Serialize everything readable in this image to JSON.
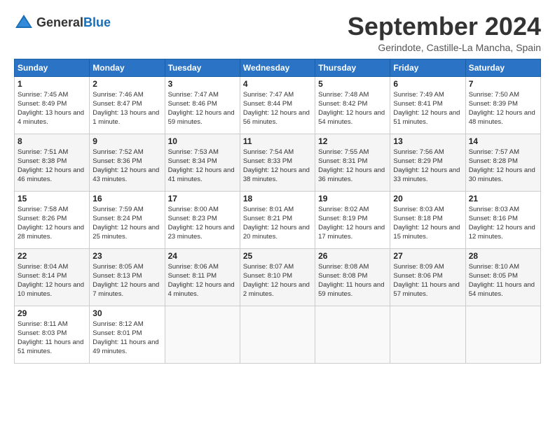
{
  "header": {
    "logo_general": "General",
    "logo_blue": "Blue",
    "title": "September 2024",
    "location": "Gerindote, Castille-La Mancha, Spain"
  },
  "days_of_week": [
    "Sunday",
    "Monday",
    "Tuesday",
    "Wednesday",
    "Thursday",
    "Friday",
    "Saturday"
  ],
  "weeks": [
    [
      {
        "day": "1",
        "sunrise": "Sunrise: 7:45 AM",
        "sunset": "Sunset: 8:49 PM",
        "daylight": "Daylight: 13 hours and 4 minutes."
      },
      {
        "day": "2",
        "sunrise": "Sunrise: 7:46 AM",
        "sunset": "Sunset: 8:47 PM",
        "daylight": "Daylight: 13 hours and 1 minute."
      },
      {
        "day": "3",
        "sunrise": "Sunrise: 7:47 AM",
        "sunset": "Sunset: 8:46 PM",
        "daylight": "Daylight: 12 hours and 59 minutes."
      },
      {
        "day": "4",
        "sunrise": "Sunrise: 7:47 AM",
        "sunset": "Sunset: 8:44 PM",
        "daylight": "Daylight: 12 hours and 56 minutes."
      },
      {
        "day": "5",
        "sunrise": "Sunrise: 7:48 AM",
        "sunset": "Sunset: 8:42 PM",
        "daylight": "Daylight: 12 hours and 54 minutes."
      },
      {
        "day": "6",
        "sunrise": "Sunrise: 7:49 AM",
        "sunset": "Sunset: 8:41 PM",
        "daylight": "Daylight: 12 hours and 51 minutes."
      },
      {
        "day": "7",
        "sunrise": "Sunrise: 7:50 AM",
        "sunset": "Sunset: 8:39 PM",
        "daylight": "Daylight: 12 hours and 48 minutes."
      }
    ],
    [
      {
        "day": "8",
        "sunrise": "Sunrise: 7:51 AM",
        "sunset": "Sunset: 8:38 PM",
        "daylight": "Daylight: 12 hours and 46 minutes."
      },
      {
        "day": "9",
        "sunrise": "Sunrise: 7:52 AM",
        "sunset": "Sunset: 8:36 PM",
        "daylight": "Daylight: 12 hours and 43 minutes."
      },
      {
        "day": "10",
        "sunrise": "Sunrise: 7:53 AM",
        "sunset": "Sunset: 8:34 PM",
        "daylight": "Daylight: 12 hours and 41 minutes."
      },
      {
        "day": "11",
        "sunrise": "Sunrise: 7:54 AM",
        "sunset": "Sunset: 8:33 PM",
        "daylight": "Daylight: 12 hours and 38 minutes."
      },
      {
        "day": "12",
        "sunrise": "Sunrise: 7:55 AM",
        "sunset": "Sunset: 8:31 PM",
        "daylight": "Daylight: 12 hours and 36 minutes."
      },
      {
        "day": "13",
        "sunrise": "Sunrise: 7:56 AM",
        "sunset": "Sunset: 8:29 PM",
        "daylight": "Daylight: 12 hours and 33 minutes."
      },
      {
        "day": "14",
        "sunrise": "Sunrise: 7:57 AM",
        "sunset": "Sunset: 8:28 PM",
        "daylight": "Daylight: 12 hours and 30 minutes."
      }
    ],
    [
      {
        "day": "15",
        "sunrise": "Sunrise: 7:58 AM",
        "sunset": "Sunset: 8:26 PM",
        "daylight": "Daylight: 12 hours and 28 minutes."
      },
      {
        "day": "16",
        "sunrise": "Sunrise: 7:59 AM",
        "sunset": "Sunset: 8:24 PM",
        "daylight": "Daylight: 12 hours and 25 minutes."
      },
      {
        "day": "17",
        "sunrise": "Sunrise: 8:00 AM",
        "sunset": "Sunset: 8:23 PM",
        "daylight": "Daylight: 12 hours and 23 minutes."
      },
      {
        "day": "18",
        "sunrise": "Sunrise: 8:01 AM",
        "sunset": "Sunset: 8:21 PM",
        "daylight": "Daylight: 12 hours and 20 minutes."
      },
      {
        "day": "19",
        "sunrise": "Sunrise: 8:02 AM",
        "sunset": "Sunset: 8:19 PM",
        "daylight": "Daylight: 12 hours and 17 minutes."
      },
      {
        "day": "20",
        "sunrise": "Sunrise: 8:03 AM",
        "sunset": "Sunset: 8:18 PM",
        "daylight": "Daylight: 12 hours and 15 minutes."
      },
      {
        "day": "21",
        "sunrise": "Sunrise: 8:03 AM",
        "sunset": "Sunset: 8:16 PM",
        "daylight": "Daylight: 12 hours and 12 minutes."
      }
    ],
    [
      {
        "day": "22",
        "sunrise": "Sunrise: 8:04 AM",
        "sunset": "Sunset: 8:14 PM",
        "daylight": "Daylight: 12 hours and 10 minutes."
      },
      {
        "day": "23",
        "sunrise": "Sunrise: 8:05 AM",
        "sunset": "Sunset: 8:13 PM",
        "daylight": "Daylight: 12 hours and 7 minutes."
      },
      {
        "day": "24",
        "sunrise": "Sunrise: 8:06 AM",
        "sunset": "Sunset: 8:11 PM",
        "daylight": "Daylight: 12 hours and 4 minutes."
      },
      {
        "day": "25",
        "sunrise": "Sunrise: 8:07 AM",
        "sunset": "Sunset: 8:10 PM",
        "daylight": "Daylight: 12 hours and 2 minutes."
      },
      {
        "day": "26",
        "sunrise": "Sunrise: 8:08 AM",
        "sunset": "Sunset: 8:08 PM",
        "daylight": "Daylight: 11 hours and 59 minutes."
      },
      {
        "day": "27",
        "sunrise": "Sunrise: 8:09 AM",
        "sunset": "Sunset: 8:06 PM",
        "daylight": "Daylight: 11 hours and 57 minutes."
      },
      {
        "day": "28",
        "sunrise": "Sunrise: 8:10 AM",
        "sunset": "Sunset: 8:05 PM",
        "daylight": "Daylight: 11 hours and 54 minutes."
      }
    ],
    [
      {
        "day": "29",
        "sunrise": "Sunrise: 8:11 AM",
        "sunset": "Sunset: 8:03 PM",
        "daylight": "Daylight: 11 hours and 51 minutes."
      },
      {
        "day": "30",
        "sunrise": "Sunrise: 8:12 AM",
        "sunset": "Sunset: 8:01 PM",
        "daylight": "Daylight: 11 hours and 49 minutes."
      },
      null,
      null,
      null,
      null,
      null
    ]
  ]
}
